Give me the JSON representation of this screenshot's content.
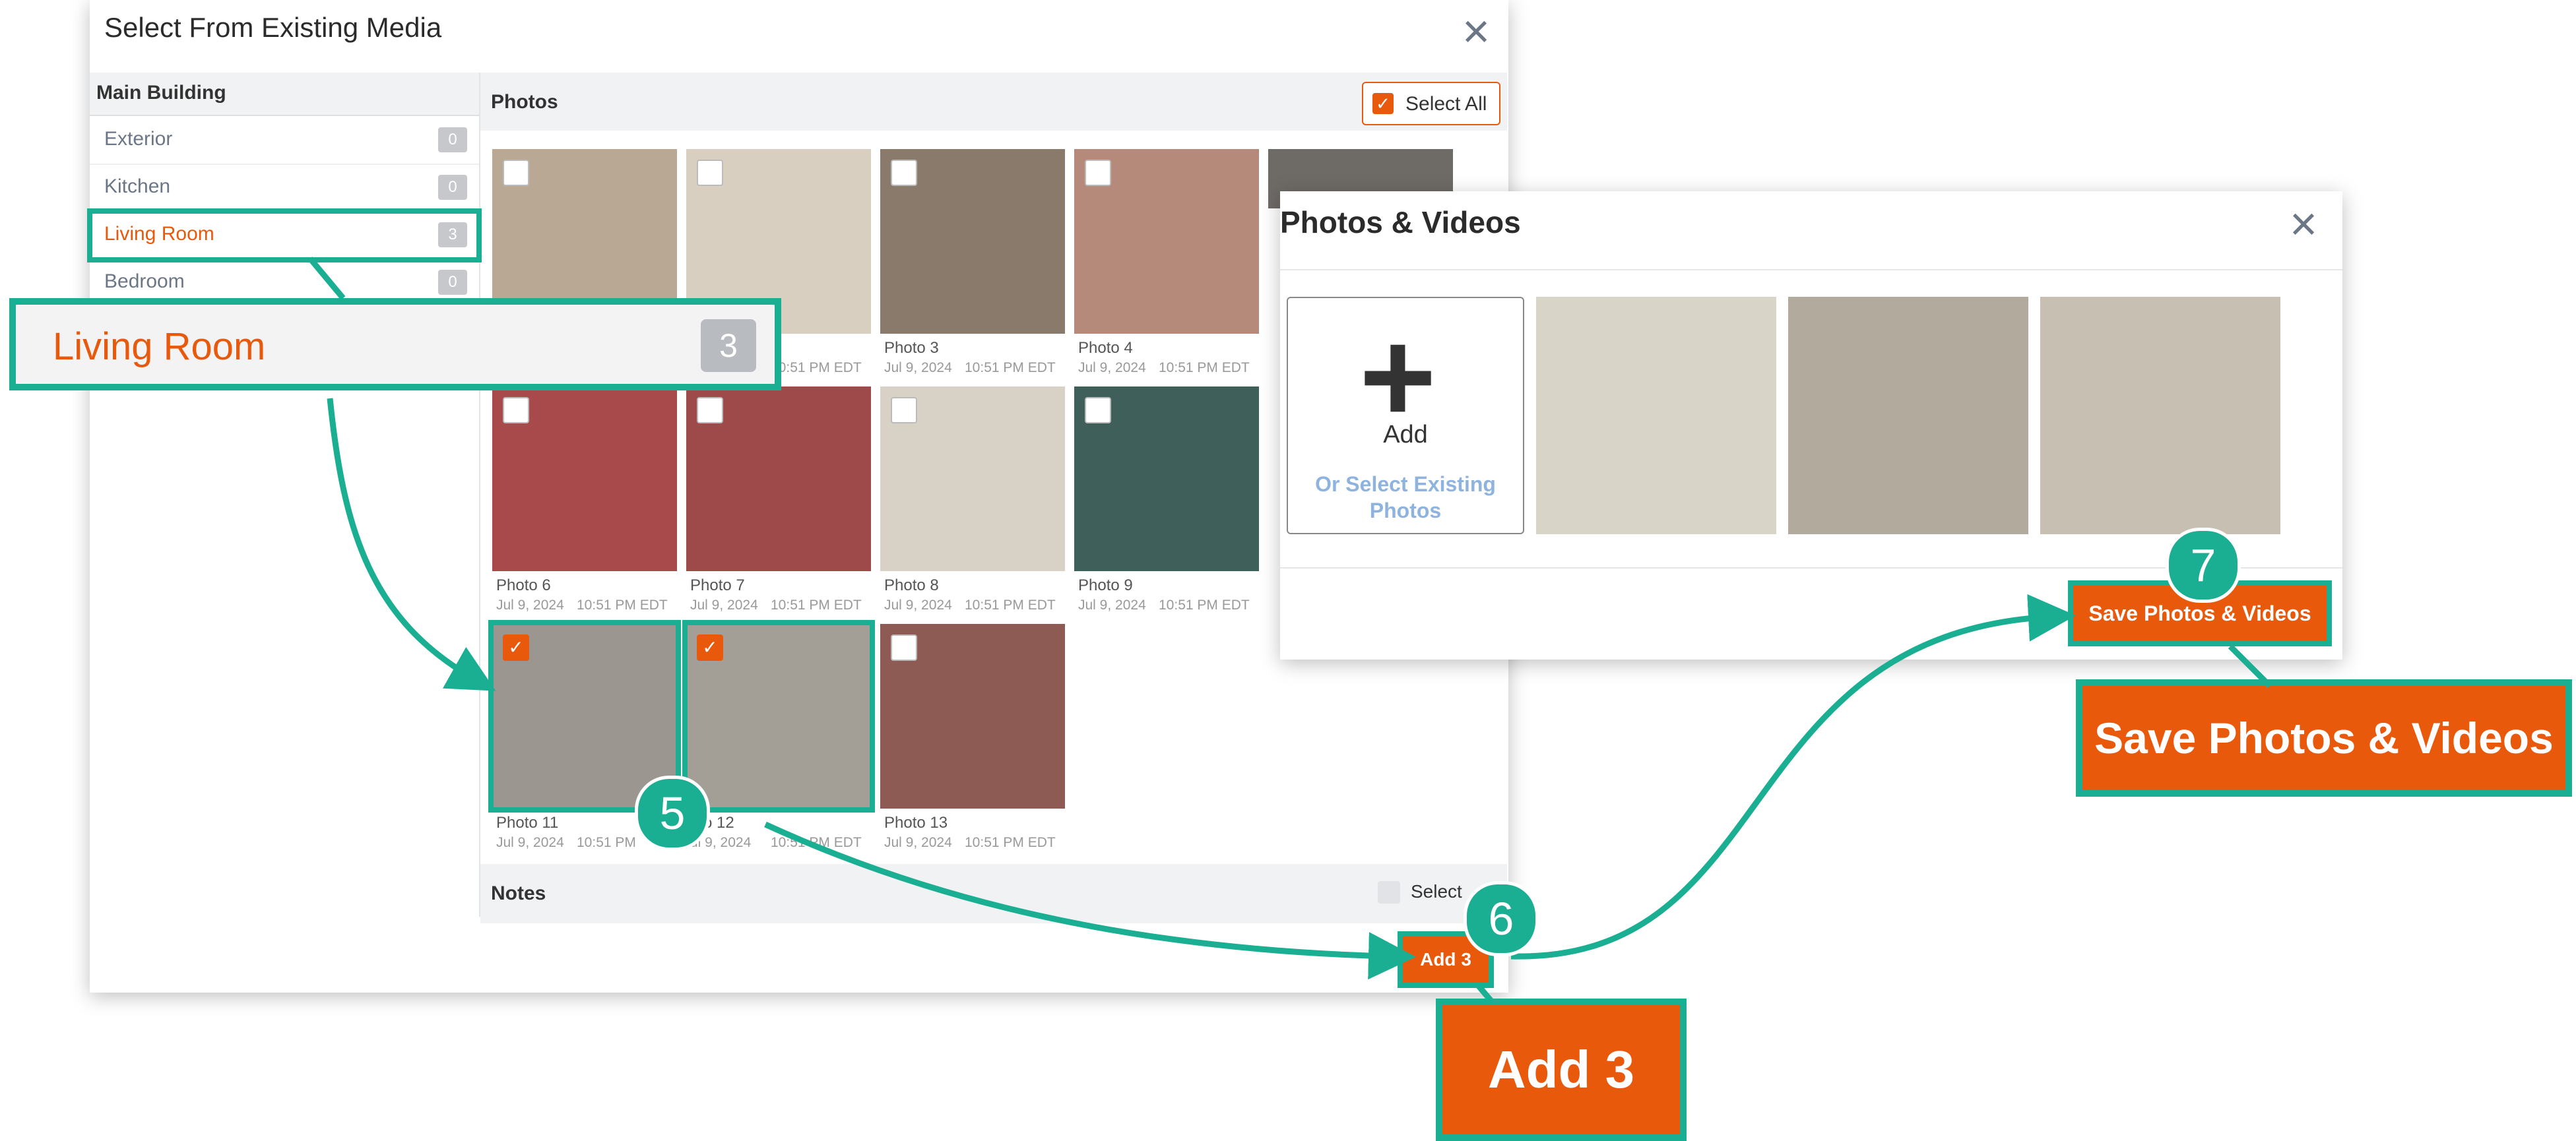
{
  "left_dialog": {
    "title": "Select From Existing Media",
    "sidebar": {
      "header": "Main Building",
      "items": [
        {
          "label": "Exterior",
          "count": "0"
        },
        {
          "label": "Kitchen",
          "count": "0"
        },
        {
          "label": "Living Room",
          "count": "3",
          "active": true
        },
        {
          "label": "Bedroom",
          "count": "0"
        }
      ]
    },
    "photos_section": {
      "label": "Photos",
      "select_all_label": "Select All",
      "tiles": [
        {
          "name": "",
          "date": "",
          "time": "",
          "checked": false
        },
        {
          "name": "",
          "date": "",
          "time": "10:51 PM EDT",
          "checked": false
        },
        {
          "name": "Photo 3",
          "date": "Jul 9, 2024",
          "time": "10:51 PM EDT",
          "checked": false
        },
        {
          "name": "Photo 4",
          "date": "Jul 9, 2024",
          "time": "10:51 PM EDT",
          "checked": false
        },
        {
          "name": "Photo 6",
          "date": "Jul 9, 2024",
          "time": "10:51 PM EDT",
          "checked": false
        },
        {
          "name": "Photo 7",
          "date": "Jul 9, 2024",
          "time": "10:51 PM EDT",
          "checked": false
        },
        {
          "name": "Photo 8",
          "date": "Jul 9, 2024",
          "time": "10:51 PM EDT",
          "checked": false
        },
        {
          "name": "Photo 9",
          "date": "Jul 9, 2024",
          "time": "10:51 PM EDT",
          "checked": false
        },
        {
          "name": "Photo 11",
          "date": "Jul 9, 2024",
          "time": "10:51 PM",
          "checked": true
        },
        {
          "name": "oto 12",
          "date": "ul 9, 2024",
          "time": "10:51 PM EDT",
          "checked": true
        },
        {
          "name": "Photo 13",
          "date": "Jul 9, 2024",
          "time": "10:51 PM EDT",
          "checked": false
        }
      ]
    },
    "notes_section": {
      "label": "Notes",
      "select_label": "Select"
    },
    "add_button": "Add 3"
  },
  "callouts": {
    "living_room": {
      "label": "Living Room",
      "count": "3"
    },
    "add_button": "Add 3",
    "save_button": "Save Photos & Videos",
    "steps": [
      "5",
      "6",
      "7"
    ]
  },
  "right_dialog": {
    "title": "Photos & Videos",
    "add_label": "Add",
    "or_select_label": "Or Select Existing Photos",
    "save_button": "Save Photos & Videos"
  },
  "colors": {
    "accent_orange": "#e8590c",
    "annotation_teal": "#1aae92"
  }
}
